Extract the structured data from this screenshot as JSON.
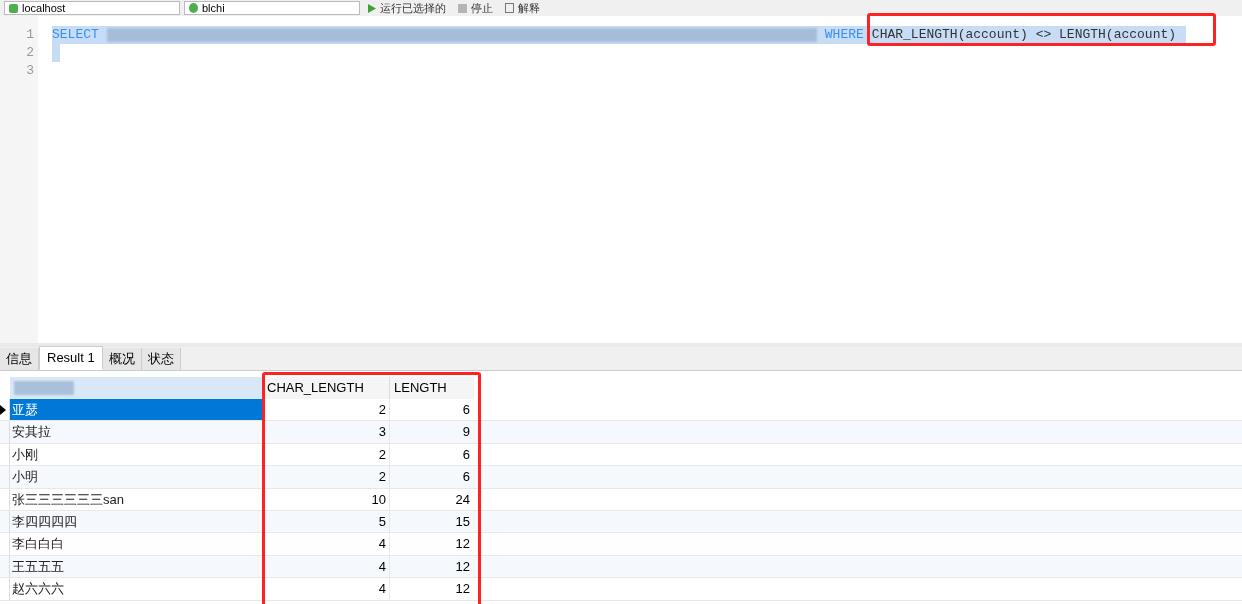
{
  "toolbar": {
    "connection": "localhost",
    "database": "blchi",
    "buttons": [
      {
        "kind": "run",
        "label": "运行已选择的"
      },
      {
        "kind": "stop",
        "label": "停止"
      },
      {
        "kind": "explain",
        "label": "解释"
      }
    ]
  },
  "editor": {
    "lines": [
      {
        "number": "1",
        "keyword": "SELECT",
        "keyword2": "WHERE",
        "code": "CHAR_LENGTH(account) <> LENGTH(account)",
        "selected": true
      },
      {
        "number": "2",
        "selected": true
      },
      {
        "number": "3",
        "selected": false
      }
    ]
  },
  "tabs": [
    {
      "label": "信息",
      "selected": false
    },
    {
      "label": "Result 1",
      "selected": true
    },
    {
      "label": "概况",
      "selected": false
    },
    {
      "label": "状态",
      "selected": false
    }
  ],
  "table": {
    "columns": [
      "CHAR_LENGTH",
      "LENGTH"
    ],
    "rows": [
      {
        "account": "亚瑟",
        "char_length": "2",
        "length": "6",
        "selected": true
      },
      {
        "account": "安其拉",
        "char_length": "3",
        "length": "9",
        "selected": false
      },
      {
        "account": "小刚",
        "char_length": "2",
        "length": "6",
        "selected": false
      },
      {
        "account": "小明",
        "char_length": "2",
        "length": "6",
        "selected": false
      },
      {
        "account": "张三三三三三三san",
        "char_length": "10",
        "length": "24",
        "selected": false
      },
      {
        "account": "李四四四四",
        "char_length": "5",
        "length": "15",
        "selected": false
      },
      {
        "account": "李白白白",
        "char_length": "4",
        "length": "12",
        "selected": false
      },
      {
        "account": "王五五五",
        "char_length": "4",
        "length": "12",
        "selected": false
      },
      {
        "account": "赵六六六",
        "char_length": "4",
        "length": "12",
        "selected": false
      }
    ]
  }
}
